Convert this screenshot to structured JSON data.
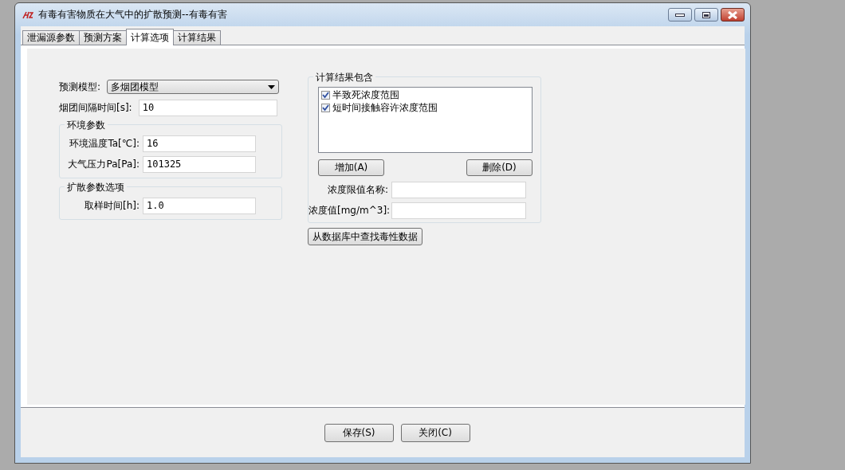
{
  "window": {
    "title": "有毒有害物质在大气中的扩散预测--有毒有害"
  },
  "tabs": [
    {
      "label": "泄漏源参数",
      "selected": false
    },
    {
      "label": "预测方案",
      "selected": false
    },
    {
      "label": "计算选项",
      "selected": true
    },
    {
      "label": "计算结果",
      "selected": false
    }
  ],
  "model": {
    "label": "预测模型:",
    "value": "多烟团模型"
  },
  "fields": [
    {
      "label": "烟团间隔时间[s]:",
      "value": "10"
    }
  ],
  "groups": [
    {
      "title": "环境参数",
      "fields": [
        {
          "label": "环境温度Ta[℃]:",
          "value": "16"
        },
        {
          "label": "大气压力Pa[Pa]:",
          "value": "101325"
        }
      ]
    },
    {
      "title": "扩散参数选项",
      "fields": [
        {
          "label": "取样时间[h]:",
          "value": "1.0"
        }
      ]
    }
  ],
  "results": {
    "title": "计算结果包含",
    "items": [
      {
        "label": "半致死浓度范围",
        "checked": true
      },
      {
        "label": "短时间接触容许浓度范围",
        "checked": true
      }
    ],
    "buttons": [
      "增加(A)",
      "删除(D)"
    ],
    "fields": [
      {
        "label": "浓度限值名称:"
      },
      {
        "label": "浓度值[mg/m^3]:"
      }
    ]
  },
  "lookup_button": "从数据库中查找毒性数据",
  "footer_buttons": [
    "保存(S)",
    "关闭(C)"
  ]
}
